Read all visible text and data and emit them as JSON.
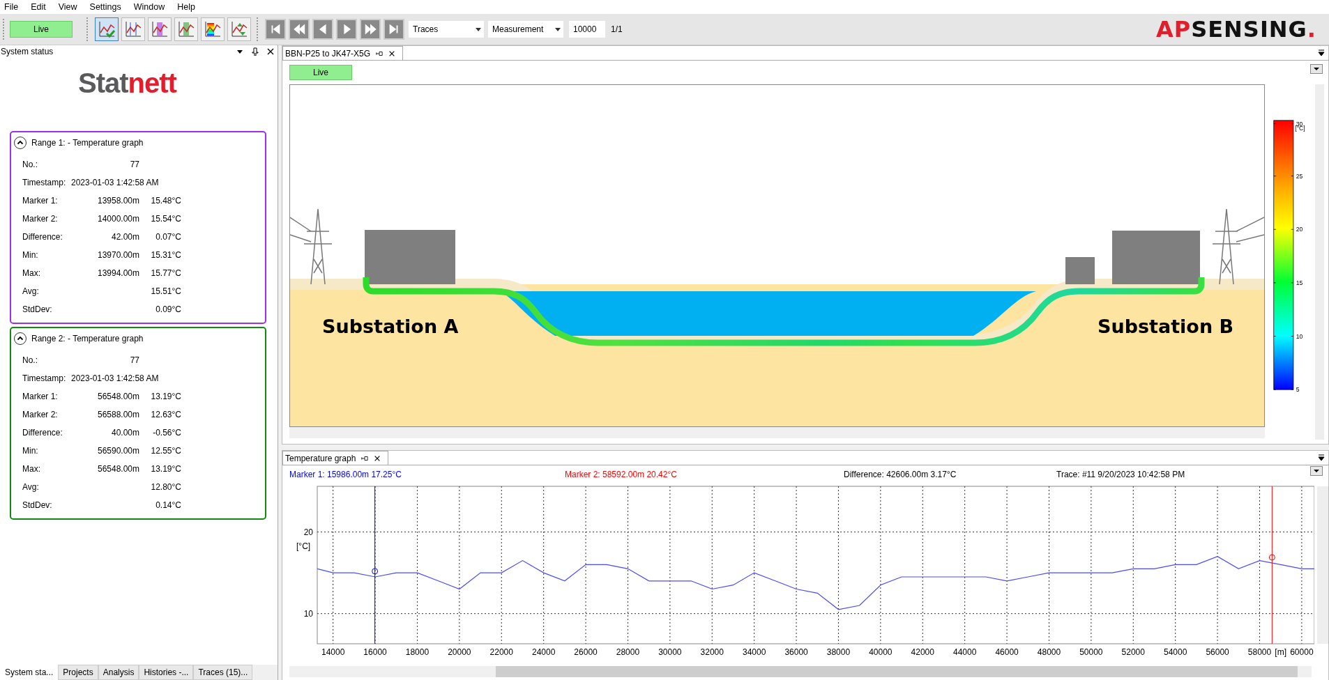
{
  "menu": [
    "File",
    "Edit",
    "View",
    "Settings",
    "Window",
    "Help"
  ],
  "toolbar": {
    "live": "Live",
    "tools": [
      {
        "kind": "trace-check",
        "selected": true
      },
      {
        "kind": "markers",
        "selected": false
      },
      {
        "kind": "range-purple",
        "selected": false
      },
      {
        "kind": "range-green",
        "selected": false
      },
      {
        "kind": "color-map",
        "selected": false
      },
      {
        "kind": "compare",
        "selected": false
      }
    ],
    "nav": [
      {
        "kind": "first"
      },
      {
        "kind": "rewind"
      },
      {
        "kind": "prev"
      },
      {
        "kind": "next"
      },
      {
        "kind": "forward"
      },
      {
        "kind": "last"
      }
    ],
    "source": "Traces",
    "mode": "Measurement",
    "count": "10000",
    "page": "1/1"
  },
  "brand": [
    "AP",
    "SENSING",
    "."
  ],
  "side_panel": {
    "title": "System status",
    "logo": [
      "Stat",
      "nett"
    ],
    "ranges": [
      {
        "title": "Range 1: - Temperature graph",
        "color": "#9b30f0",
        "expanded": true,
        "rows": [
          {
            "label": "No.:",
            "dist": "77",
            "temp": ""
          },
          {
            "label": "Timestamp:",
            "dist": "2023-01-03 1:42:58 AM",
            "temp": ""
          },
          {
            "label": "Marker 1:",
            "dist": "13958.00m",
            "temp": "15.48°C"
          },
          {
            "label": "Marker 2:",
            "dist": "14000.00m",
            "temp": "15.54°C"
          },
          {
            "label": "Difference:",
            "dist": "42.00m",
            "temp": "0.07°C"
          },
          {
            "label": "Min:",
            "dist": "13970.00m",
            "temp": "15.31°C"
          },
          {
            "label": "Max:",
            "dist": "13994.00m",
            "temp": "15.77°C"
          },
          {
            "label": "Avg:",
            "dist": "",
            "temp": "15.51°C"
          },
          {
            "label": "StdDev:",
            "dist": "",
            "temp": "0.09°C"
          }
        ]
      },
      {
        "title": "Range 2: - Temperature graph",
        "color": "#108a10",
        "expanded": true,
        "rows": [
          {
            "label": "No.:",
            "dist": "77",
            "temp": ""
          },
          {
            "label": "Timestamp:",
            "dist": "2023-01-03 1:42:58 AM",
            "temp": ""
          },
          {
            "label": "Marker 1:",
            "dist": "56548.00m",
            "temp": "13.19°C"
          },
          {
            "label": "Marker 2:",
            "dist": "56588.00m",
            "temp": "12.63°C"
          },
          {
            "label": "Difference:",
            "dist": "40.00m",
            "temp": "-0.56°C"
          },
          {
            "label": "Min:",
            "dist": "56590.00m",
            "temp": "12.55°C"
          },
          {
            "label": "Max:",
            "dist": "56548.00m",
            "temp": "13.19°C"
          },
          {
            "label": "Avg:",
            "dist": "",
            "temp": "12.80°C"
          },
          {
            "label": "StdDev:",
            "dist": "",
            "temp": "0.14°C"
          }
        ]
      }
    ],
    "tabs": [
      {
        "label": "System sta...",
        "selected": true
      },
      {
        "label": "Projects",
        "selected": false
      },
      {
        "label": "Analysis",
        "selected": false
      },
      {
        "label": "Histories -...",
        "selected": false
      },
      {
        "label": "Traces (15)...",
        "selected": false
      }
    ]
  },
  "document": {
    "tab": "BBN-P25 to JK47-X5G",
    "live": "Live",
    "labels": [
      "Substation A",
      "Substation B"
    ],
    "colorbar": {
      "unit": "[°C]",
      "ticks": [
        "30",
        "25",
        "20",
        "15",
        "10",
        "5"
      ]
    }
  },
  "graph_panel": {
    "tab": "Temperature graph",
    "header": [
      {
        "text": "Marker 1: 15986.00m 17.25°C",
        "color": "#0000ff"
      },
      {
        "text": "Marker 2: 58592.00m 20.42°C",
        "color": "#ff0000"
      },
      {
        "text": "Difference: 42606.00m 3.17°C",
        "color": "#000000"
      },
      {
        "text": "Trace: #11 9/20/2023 10:42:58 PM",
        "color": "#000000"
      }
    ],
    "chart_data": {
      "type": "line",
      "xlabel": "[m]",
      "ylabel": "[°C]",
      "xlim": [
        13250,
        60600
      ],
      "ylim": [
        6.3,
        25.6
      ],
      "xticks": [
        14000,
        16000,
        18000,
        20000,
        22000,
        24000,
        26000,
        28000,
        30000,
        32000,
        34000,
        36000,
        38000,
        40000,
        42000,
        44000,
        46000,
        48000,
        50000,
        52000,
        54000,
        56000,
        58000,
        60000
      ],
      "yticks": [
        10,
        20
      ],
      "x": [
        13250,
        14000,
        15000,
        16000,
        17000,
        18000,
        19000,
        20000,
        21000,
        22000,
        23000,
        24000,
        25000,
        26000,
        27000,
        28000,
        29000,
        30000,
        31000,
        32000,
        33000,
        34000,
        35000,
        36000,
        37000,
        38000,
        39000,
        40000,
        41000,
        42000,
        43000,
        44000,
        45000,
        46000,
        47000,
        48000,
        49000,
        50000,
        51000,
        52000,
        53000,
        54000,
        55000,
        56000,
        57000,
        58000,
        59000,
        60000,
        60600
      ],
      "grid": true,
      "series": [
        {
          "color": "#4a4aff",
          "values": [
            15.5,
            15,
            15,
            14.5,
            15,
            15,
            14,
            13,
            15,
            15,
            16.5,
            15,
            14,
            16,
            16,
            15.5,
            14,
            14,
            14,
            13,
            13.5,
            15,
            14,
            13,
            12.5,
            10.5,
            11,
            13.5,
            14.5,
            14.5,
            14.5,
            14.5,
            14.5,
            14,
            14.5,
            15,
            15,
            15,
            15,
            15.5,
            15.5,
            16,
            16,
            17,
            15.5,
            16.5,
            16,
            15.5,
            15.5
          ]
        }
      ],
      "ref_lines": [
        {
          "axis": "x",
          "value": 15986,
          "color": "#0000ff"
        },
        {
          "axis": "x",
          "value": 58592,
          "color": "#ff0000"
        }
      ]
    }
  }
}
